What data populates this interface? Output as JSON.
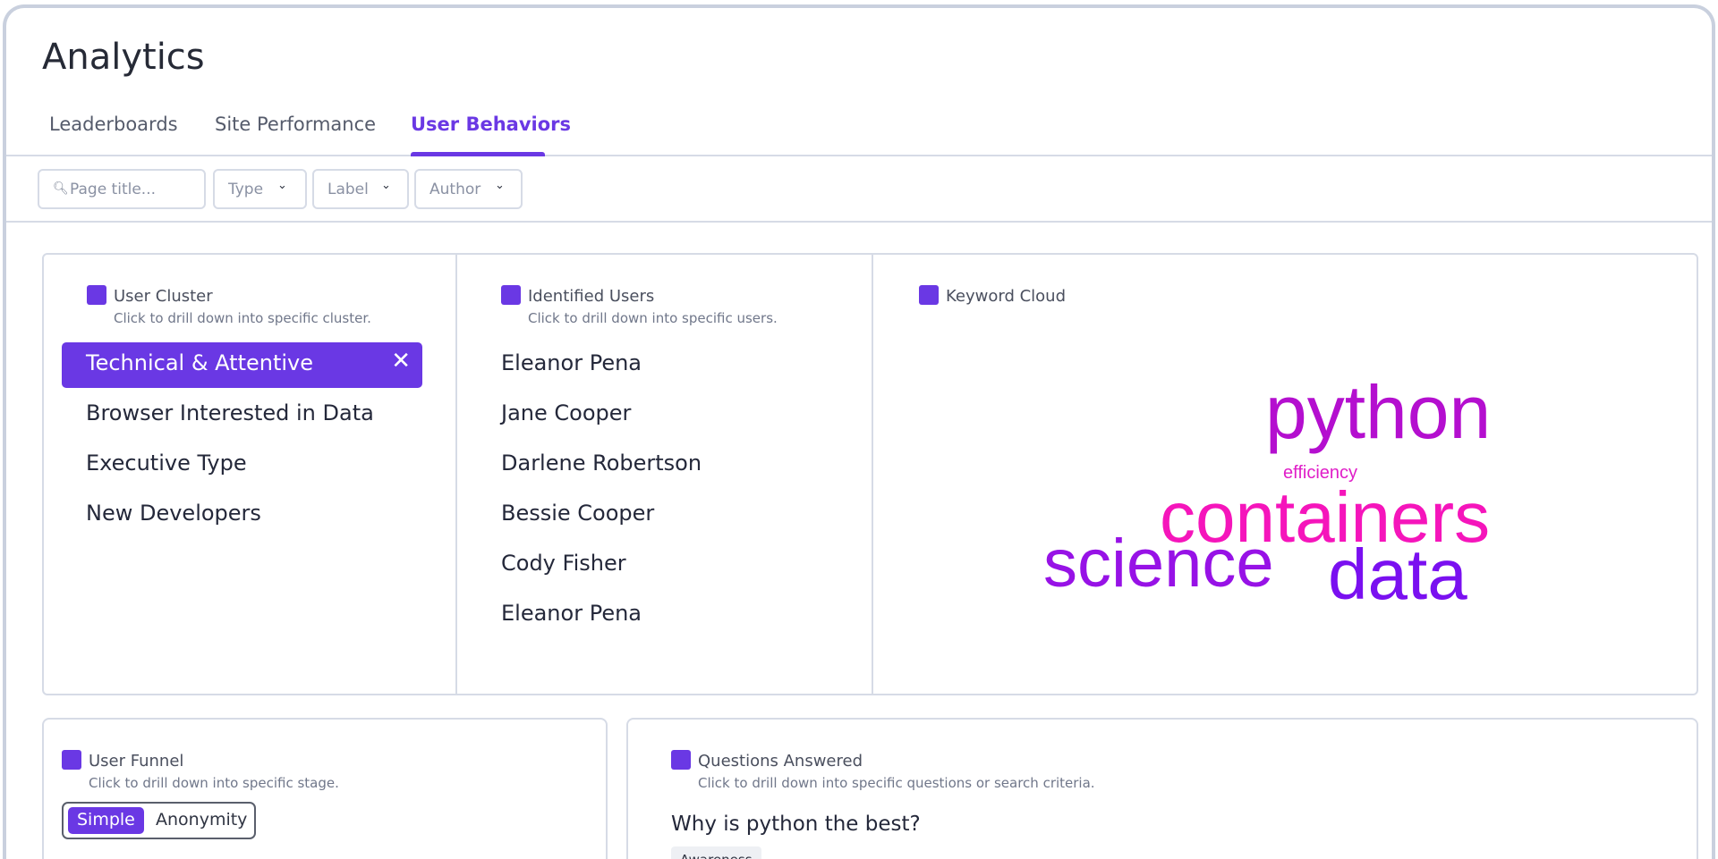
{
  "page": {
    "title": "Analytics"
  },
  "tabs": [
    {
      "label": "Leaderboards"
    },
    {
      "label": "Site Performance"
    },
    {
      "label": "User Behaviors",
      "active": true
    }
  ],
  "filters": {
    "search_placeholder": "Page title...",
    "search_icon": "search-icon",
    "type_label": "Type",
    "label_label": "Label",
    "author_label": "Author"
  },
  "user_cluster": {
    "title": "User Cluster",
    "subtitle": "Click to drill down into specific cluster.",
    "items": [
      {
        "label": "Technical & Attentive",
        "selected": true
      },
      {
        "label": "Browser Interested in Data"
      },
      {
        "label": "Executive Type"
      },
      {
        "label": "New Developers"
      }
    ],
    "clear_glyph": "✕"
  },
  "identified_users": {
    "title": "Identified Users",
    "subtitle": "Click to drill down into specific users.",
    "items": [
      "Eleanor Pena",
      "Jane Cooper",
      "Darlene Robertson",
      "Bessie Cooper",
      "Cody Fisher",
      "Eleanor Pena"
    ]
  },
  "keyword_cloud": {
    "title": "Keyword Cloud",
    "words": [
      {
        "text": "python",
        "color": "#b40fcf"
      },
      {
        "text": "efficiency",
        "color": "#e01ec8"
      },
      {
        "text": "containers",
        "color": "#f515bb"
      },
      {
        "text": "science",
        "color": "#9712e6"
      },
      {
        "text": "data",
        "color": "#7a10f0"
      }
    ]
  },
  "user_funnel": {
    "title": "User Funnel",
    "subtitle": "Click to drill down into specific stage.",
    "toggle": {
      "simple": "Simple",
      "anonymity": "Anonymity"
    }
  },
  "questions": {
    "title": "Questions Answered",
    "subtitle": "Click to drill down into specific questions or search criteria.",
    "question": "Why is python the best?",
    "tag": "Awareness"
  },
  "colors": {
    "accent": "#6a38e4",
    "border": "#d6dbe6",
    "funnel": "#1b9a8a"
  }
}
